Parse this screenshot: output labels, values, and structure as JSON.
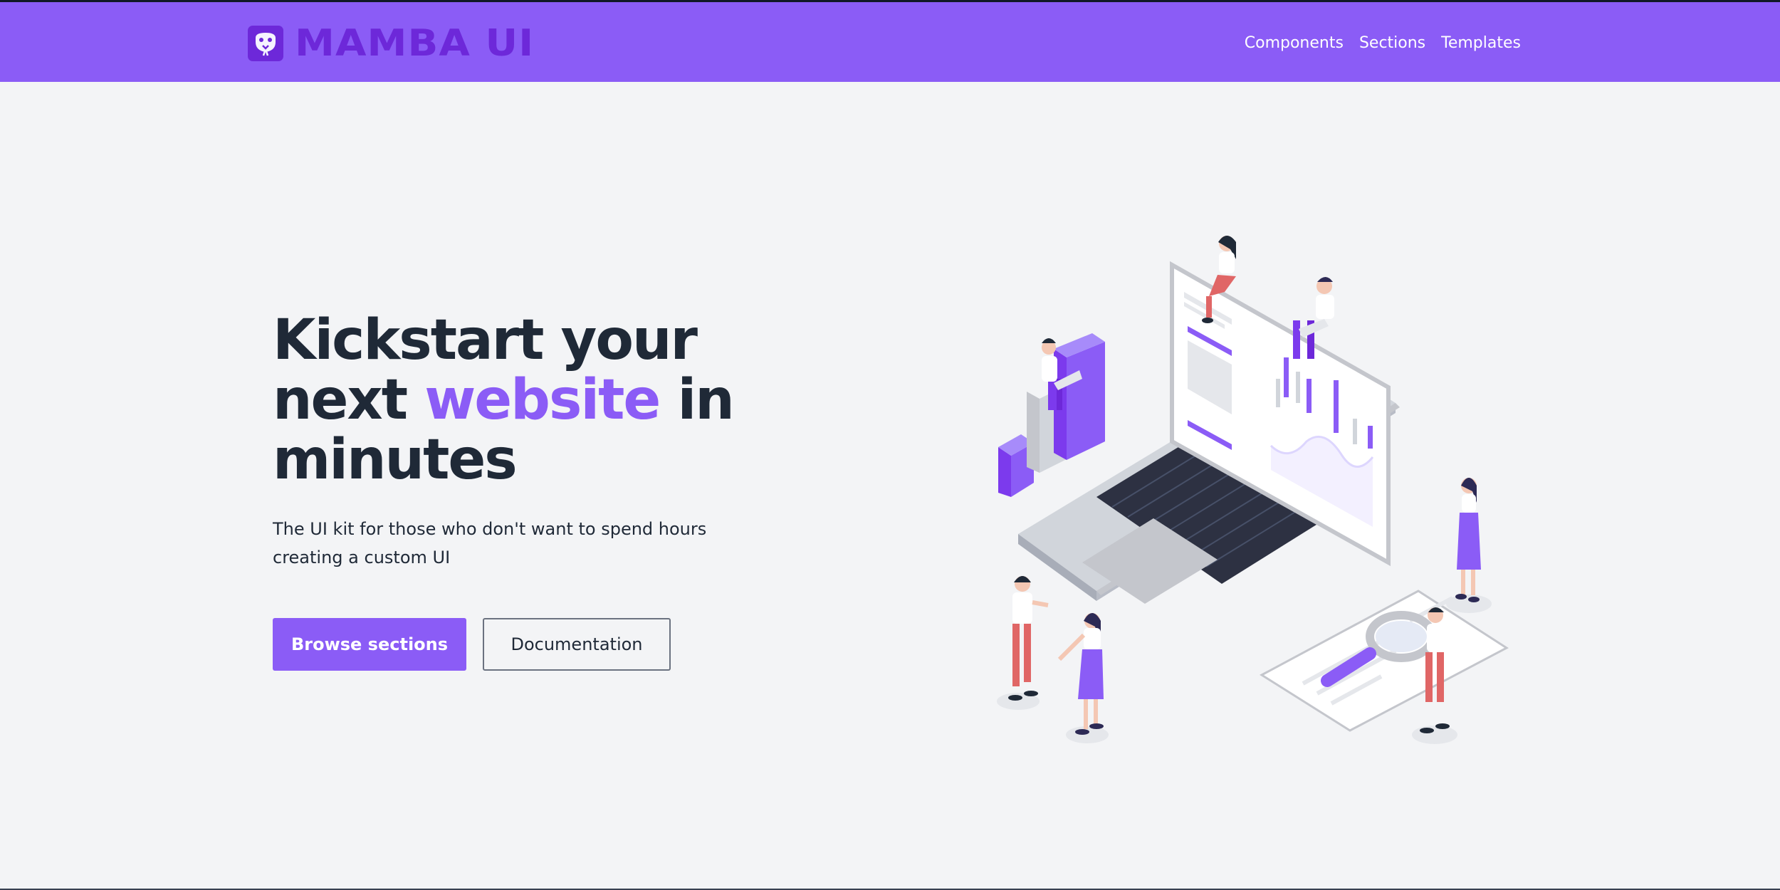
{
  "header": {
    "brand": "MAMBA UI",
    "nav": [
      "Components",
      "Sections",
      "Templates"
    ],
    "background": "#8b5cf6",
    "logo_color": "#6d28d9"
  },
  "hero": {
    "title_part1": "Kickstart your next ",
    "title_accent": "website",
    "title_part2": " in minutes",
    "subtitle": "The UI kit for those who don't want to spend hours creating a custom UI",
    "primary_button": "Browse sections",
    "secondary_button": "Documentation",
    "accent_color": "#8b5cf6"
  },
  "illustration": {
    "icon": "laptop-team-illustration"
  }
}
